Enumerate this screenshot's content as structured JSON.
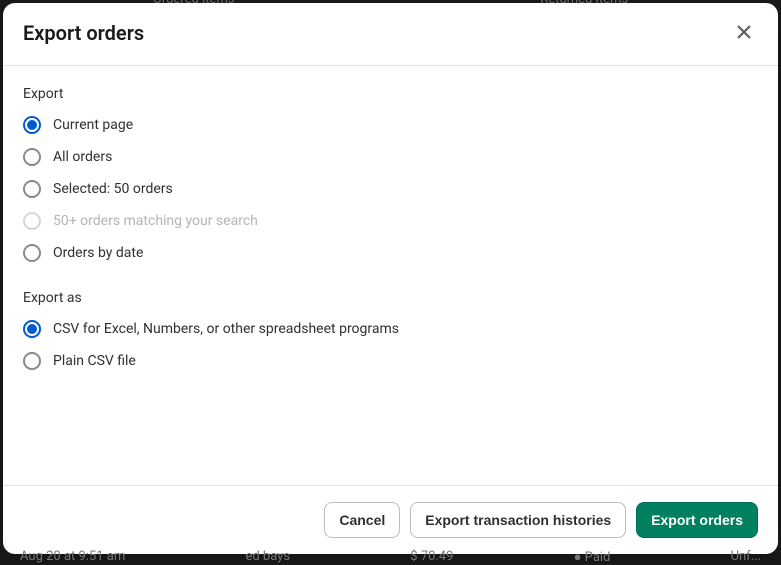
{
  "modal": {
    "title": "Export orders",
    "sections": {
      "export": {
        "label": "Export",
        "options": [
          {
            "id": "current-page",
            "label": "Current page",
            "selected": true,
            "disabled": false
          },
          {
            "id": "all-orders",
            "label": "All orders",
            "selected": false,
            "disabled": false
          },
          {
            "id": "selected-orders",
            "label": "Selected: 50 orders",
            "selected": false,
            "disabled": false
          },
          {
            "id": "matching-search",
            "label": "50+ orders matching your search",
            "selected": false,
            "disabled": true
          },
          {
            "id": "orders-by-date",
            "label": "Orders by date",
            "selected": false,
            "disabled": false
          }
        ]
      },
      "export_as": {
        "label": "Export as",
        "options": [
          {
            "id": "csv-spreadsheet",
            "label": "CSV for Excel, Numbers, or other spreadsheet programs",
            "selected": true,
            "disabled": false
          },
          {
            "id": "plain-csv",
            "label": "Plain CSV file",
            "selected": false,
            "disabled": false
          }
        ]
      }
    },
    "footer": {
      "cancel_label": "Cancel",
      "export_histories_label": "Export transaction histories",
      "export_orders_label": "Export orders"
    }
  }
}
